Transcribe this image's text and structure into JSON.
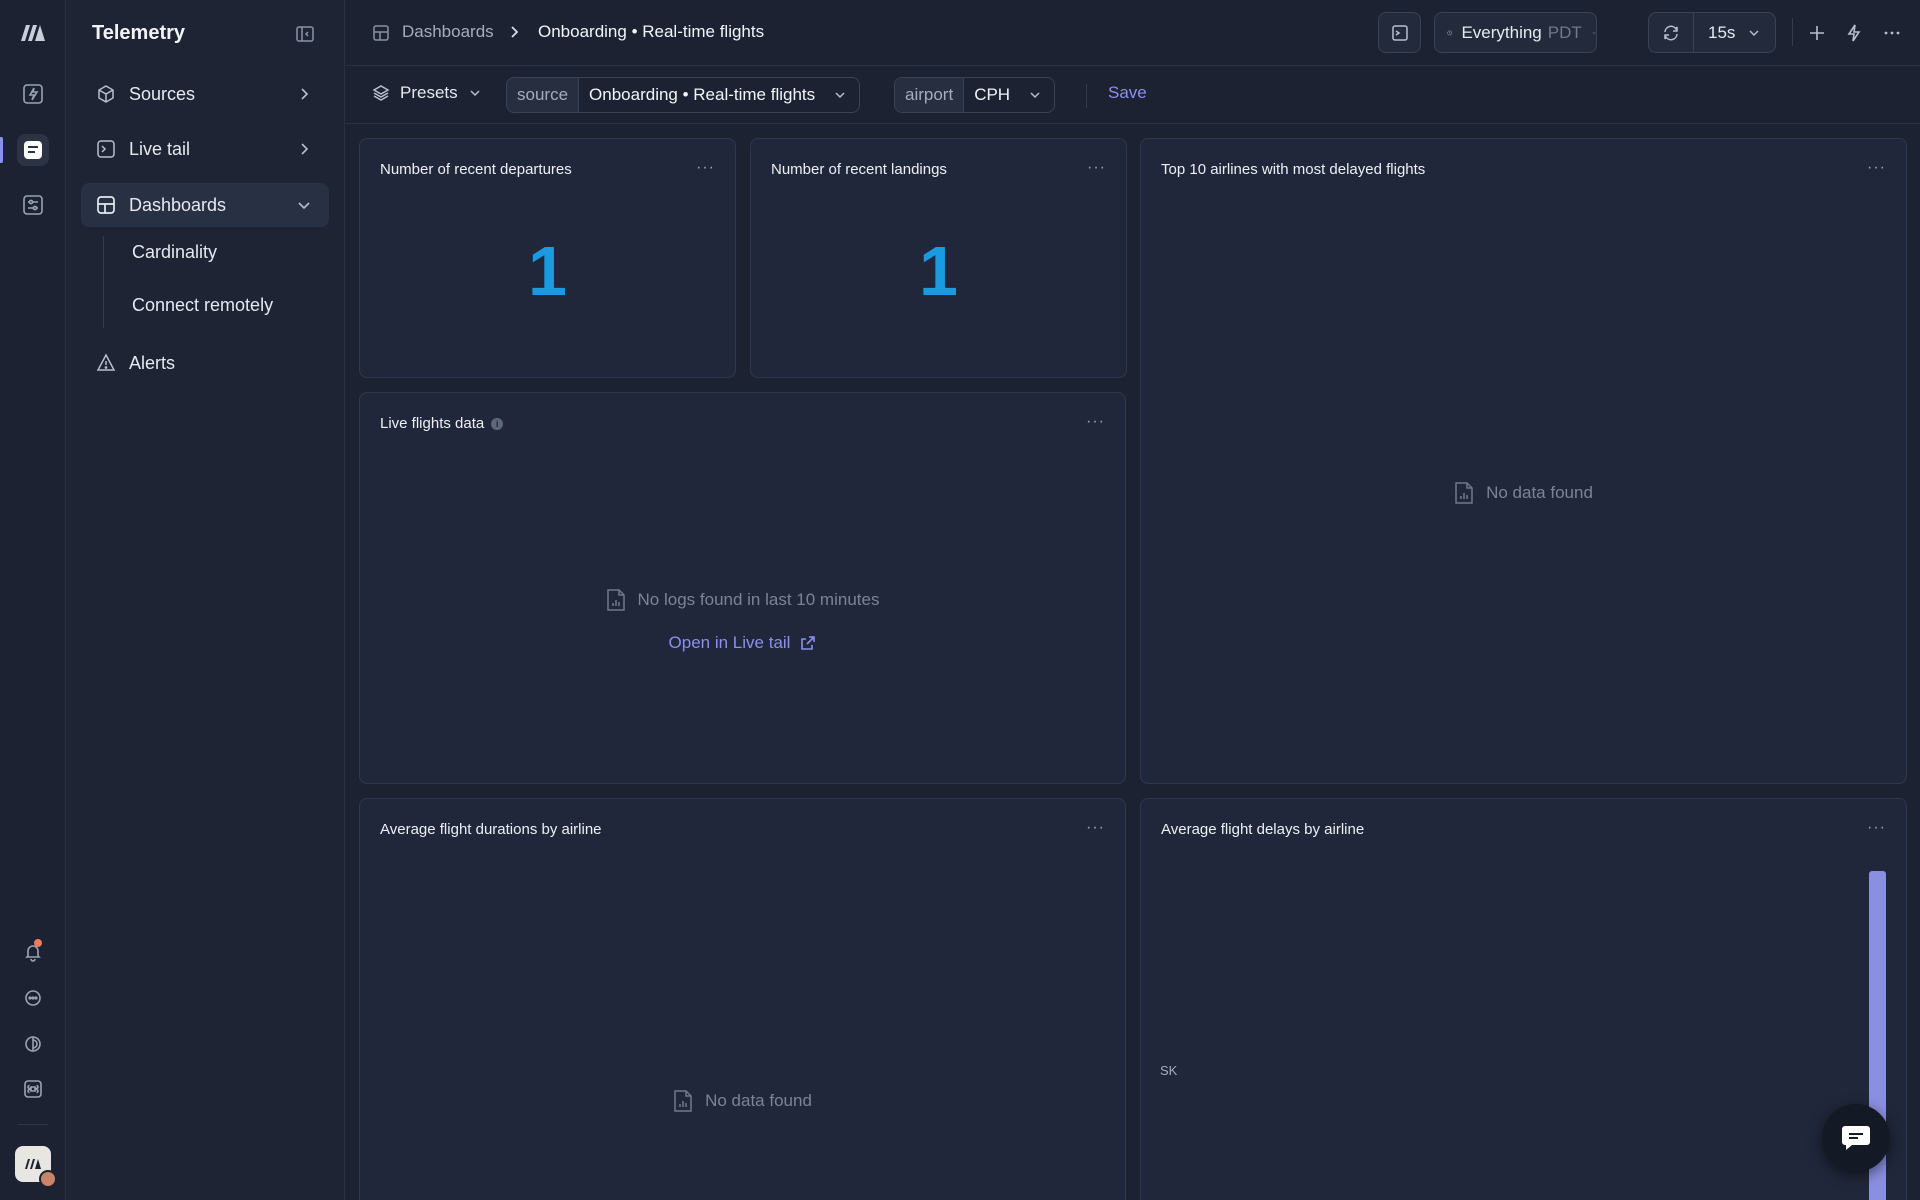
{
  "sidebar": {
    "title": "Telemetry",
    "items": [
      {
        "label": "Sources"
      },
      {
        "label": "Live tail"
      },
      {
        "label": "Dashboards"
      },
      {
        "label": "Alerts"
      }
    ],
    "sub_items": [
      {
        "label": "Cardinality"
      },
      {
        "label": "Connect remotely"
      }
    ]
  },
  "breadcrumb": {
    "parent": "Dashboards",
    "current": "Onboarding • Real-time flights"
  },
  "toolbar": {
    "time_range": "Everything",
    "timezone": "PDT",
    "refresh_interval": "15s"
  },
  "filters": {
    "presets_label": "Presets",
    "source_key": "source",
    "source_value": "Onboarding • Real-time flights",
    "airport_key": "airport",
    "airport_value": "CPH",
    "save_label": "Save"
  },
  "panels": {
    "departures": {
      "title": "Number of recent departures",
      "value": "1"
    },
    "landings": {
      "title": "Number of recent landings",
      "value": "1"
    },
    "top_airlines": {
      "title": "Top 10 airlines with most delayed flights",
      "empty": "No data found"
    },
    "live_flights": {
      "title": "Live flights data",
      "empty": "No logs found in last 10 minutes",
      "link": "Open in Live tail"
    },
    "avg_durations": {
      "title": "Average flight durations by airline",
      "empty": "No data found"
    },
    "avg_delays": {
      "title": "Average flight delays by airline",
      "category_label": "SK"
    }
  },
  "colors": {
    "accent": "#8b8ff0",
    "number": "#1a9ae0",
    "background": "#1c2232",
    "notification": "#f07a5a"
  },
  "icons": {
    "rail": [
      "logo-icon",
      "bolt-icon",
      "dashboard-icon",
      "sliders-icon",
      "bell-icon",
      "chat-icon",
      "status-icon",
      "command-icon"
    ],
    "menu": "more-horizontal-icon"
  }
}
